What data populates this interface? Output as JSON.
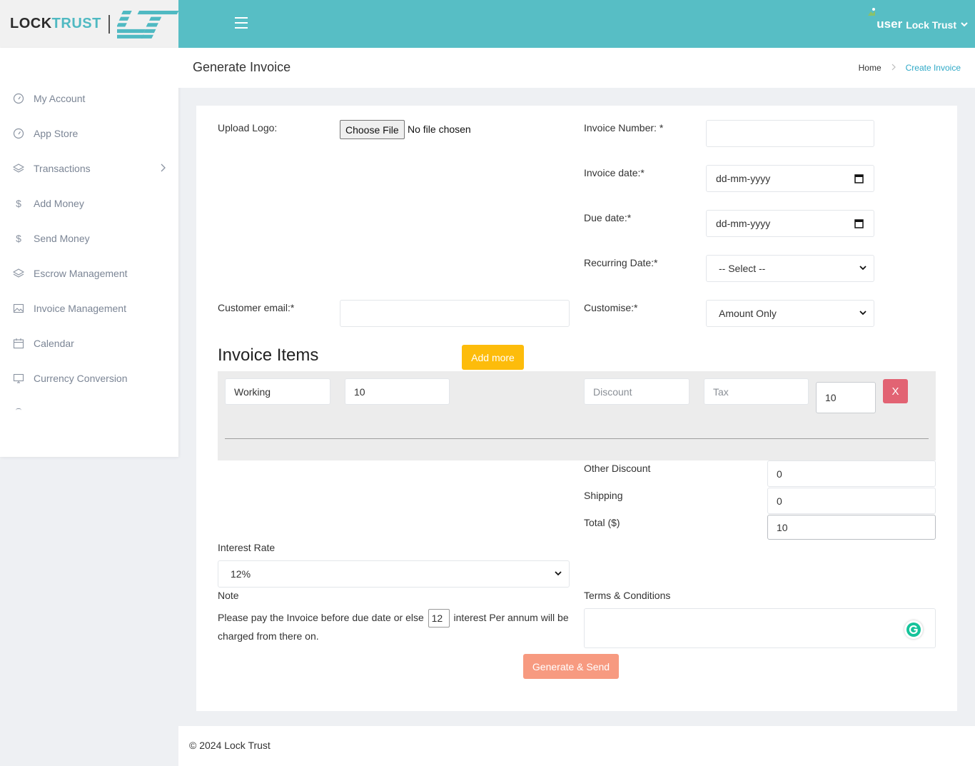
{
  "brand": {
    "name_part1": "LOCK",
    "name_part2": "TRUST",
    "accent_color": "#57bec5"
  },
  "topbar": {
    "user_word": "user",
    "user_name": "Lock Trust"
  },
  "sidebar": {
    "items": [
      {
        "label": "My Account",
        "icon": "dashboard-icon"
      },
      {
        "label": "App Store",
        "icon": "dashboard-icon"
      },
      {
        "label": "Transactions",
        "icon": "layers-icon"
      },
      {
        "label": "Add Money",
        "icon": "dollar-icon"
      },
      {
        "label": "Send Money",
        "icon": "dollar-icon"
      },
      {
        "label": "Escrow Management",
        "icon": "layers-icon"
      },
      {
        "label": "Invoice Management",
        "icon": "image-icon"
      },
      {
        "label": "Calendar",
        "icon": "calendar-icon"
      },
      {
        "label": "Currency Conversion",
        "icon": "monitor-icon"
      }
    ]
  },
  "header": {
    "title": "Generate Invoice",
    "breadcrumb_home": "Home",
    "breadcrumb_current": "Create Invoice"
  },
  "form": {
    "upload_logo_label": "Upload Logo:",
    "choose_file_label": "Choose File",
    "no_file_text": "No file chosen",
    "invoice_number_label": "Invoice Number: *",
    "invoice_number_value": "",
    "invoice_date_label": "Invoice date:*",
    "invoice_date_value": "dd-mm-yyyy",
    "due_date_label": "Due date:*",
    "due_date_value": "dd-mm-yyyy",
    "recurring_label": "Recurring Date:*",
    "recurring_value": "-- Select --",
    "customer_email_label": "Customer email:*",
    "customer_email_value": "",
    "customise_label": "Customise:*",
    "customise_value": "Amount Only"
  },
  "items": {
    "title": "Invoice Items",
    "add_more_label": "Add more",
    "row": {
      "name": "Working",
      "amount": "10",
      "discount_placeholder": "Discount",
      "tax_placeholder": "Tax",
      "line_total": "10",
      "remove_label": "X"
    }
  },
  "totals": {
    "other_discount_label": "Other Discount",
    "other_discount_value": "0",
    "shipping_label": "Shipping",
    "shipping_value": "0",
    "total_label": "Total ($)",
    "total_value": "10"
  },
  "interest": {
    "label": "Interest Rate",
    "value": "12%"
  },
  "note": {
    "label": "Note",
    "text_before": "Please pay the Invoice before due date or else",
    "rate": "12",
    "text_after": "interest Per annum will be charged from there on."
  },
  "terms": {
    "label": "Terms & Conditions",
    "value": ""
  },
  "actions": {
    "generate_label": "Generate & Send"
  },
  "footer": {
    "copyright": "© 2024 Lock Trust"
  }
}
